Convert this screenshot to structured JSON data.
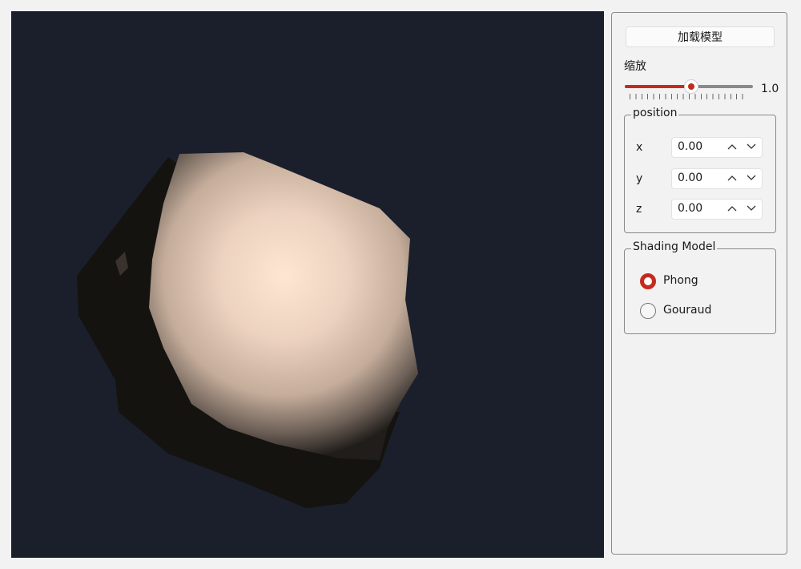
{
  "viewport": {
    "background": "#1a1f2b",
    "model_color": "#f2d8c4"
  },
  "controls": {
    "load_button_label": "加载模型",
    "zoom": {
      "label": "缩放",
      "value_text": "1.0",
      "value_fraction": 0.52
    },
    "position": {
      "title": "position",
      "fields": [
        {
          "axis": "x",
          "value": "0.00"
        },
        {
          "axis": "y",
          "value": "0.00"
        },
        {
          "axis": "z",
          "value": "0.00"
        }
      ]
    },
    "shading": {
      "title": "Shading Model",
      "options": [
        {
          "label": "Phong",
          "selected": true
        },
        {
          "label": "Gouraud",
          "selected": false
        }
      ]
    },
    "accent_color": "#c42b1c"
  }
}
